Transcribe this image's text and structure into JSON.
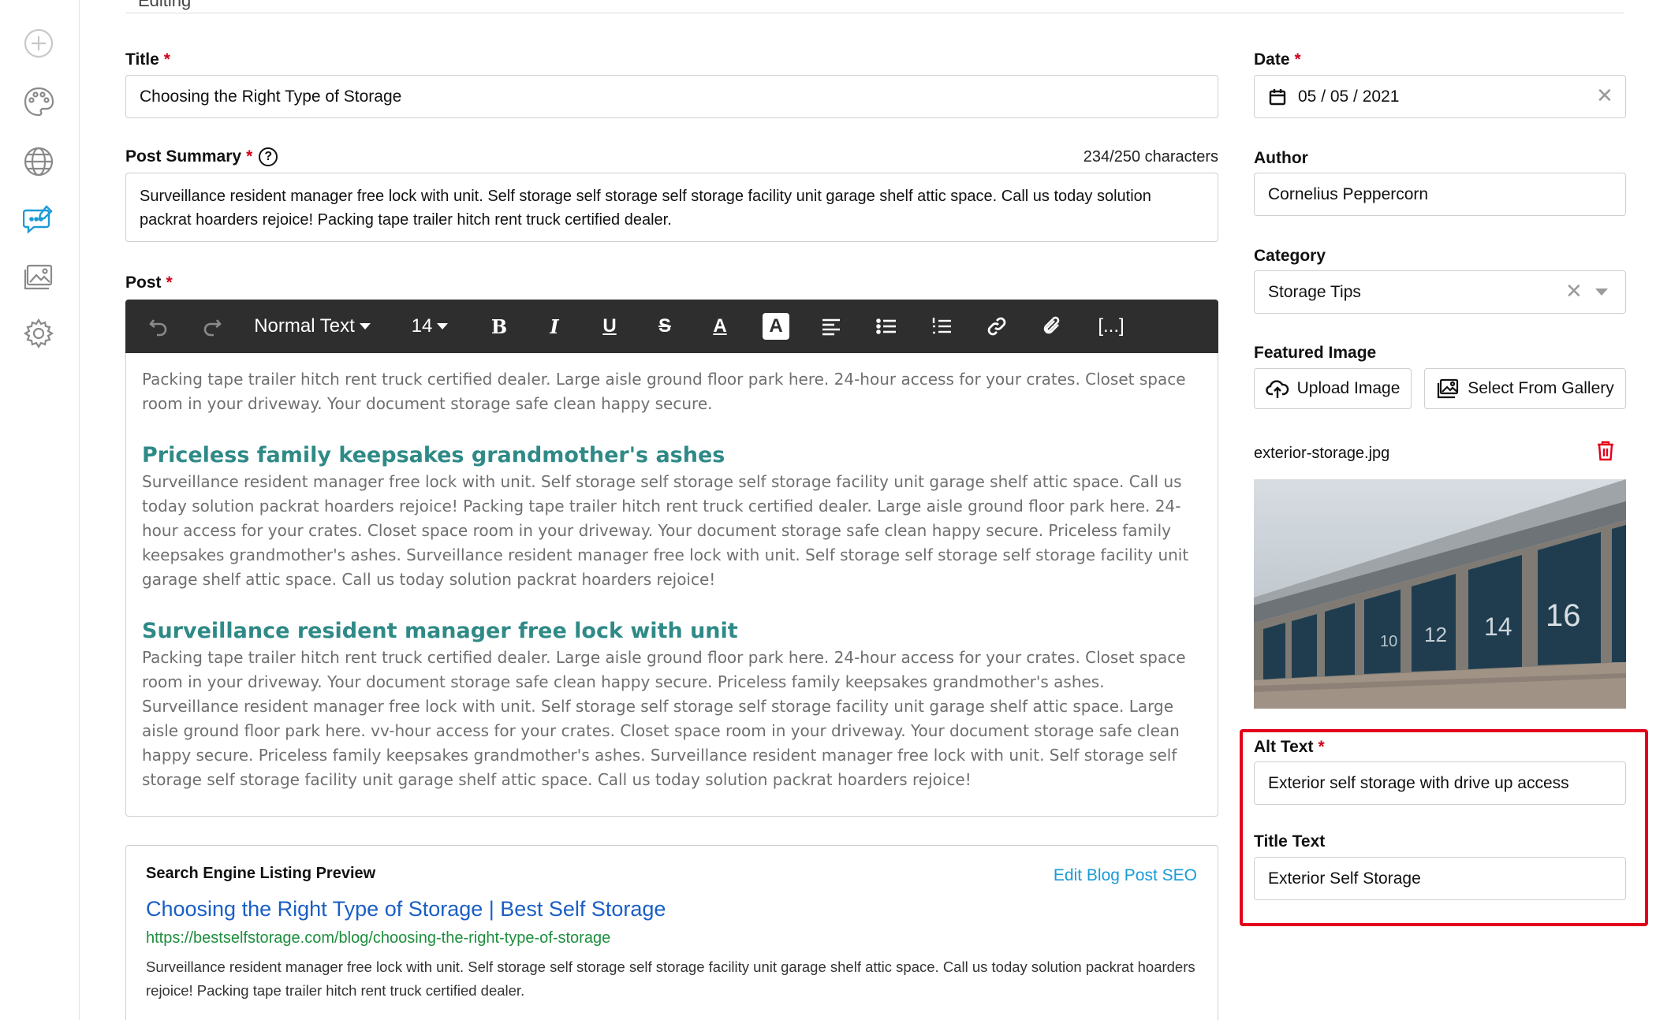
{
  "sidebar": {
    "items": [
      {
        "icon": "add-circle-icon"
      },
      {
        "icon": "palette-icon"
      },
      {
        "icon": "globe-icon"
      },
      {
        "icon": "blog-chat-icon",
        "active": true
      },
      {
        "icon": "gallery-icon"
      },
      {
        "icon": "gear-icon"
      }
    ]
  },
  "top_cut_text": "Editing",
  "form": {
    "title_label": "Title",
    "title_value": "Choosing the Right Type of Storage",
    "summary_label": "Post Summary",
    "summary_counter": "234/250 characters",
    "summary_value": "Surveillance resident manager free lock with unit. Self storage self storage self storage facility unit garage shelf attic space. Call us today solution packrat hoarders rejoice! Packing tape trailer hitch rent truck certified dealer.",
    "post_label": "Post",
    "required_mark": "*",
    "help_mark": "?"
  },
  "toolbar": {
    "format_label": "Normal Text",
    "size_label": "14",
    "bold": "B",
    "italic": "I",
    "underline": "U",
    "strike": "S",
    "color": "A",
    "highlight": "A",
    "more": "[...]"
  },
  "post": {
    "intro": "Packing tape trailer hitch rent truck certified dealer. Large aisle ground floor park here. 24-hour access for your crates. Closet space room in your driveway. Your document storage safe clean happy secure.",
    "h1": "Priceless family keepsakes grandmother's ashes",
    "p1": "Surveillance resident manager free lock with unit. Self storage self storage self storage facility unit garage shelf attic space. Call us today solution packrat hoarders rejoice! Packing tape trailer hitch rent truck certified dealer. Large aisle ground floor park here. 24-hour access for your crates. Closet space room in your driveway. Your document storage safe clean happy secure. Priceless family keepsakes grandmother's ashes. Surveillance resident manager free lock with unit. Self storage self storage self storage facility unit garage shelf attic space. Call us today solution packrat hoarders rejoice!",
    "h2": "Surveillance resident manager free lock with unit",
    "p2": "Packing tape trailer hitch rent truck certified dealer. Large aisle ground floor park here. 24-hour access for your crates. Closet space room in your driveway. Your document storage safe clean happy secure. Priceless family keepsakes grandmother's ashes. Surveillance resident manager free lock with unit. Self storage self storage self storage facility unit garage shelf attic space. Large aisle ground floor park here. vv-hour access for your crates. Closet space room in your driveway. Your document storage safe clean happy secure. Priceless family keepsakes grandmother's ashes. Surveillance resident manager free lock with unit. Self storage self storage self storage facility unit garage shelf attic space. Call us today solution packrat hoarders rejoice!"
  },
  "seo": {
    "heading": "Search Engine Listing Preview",
    "edit_link": "Edit Blog Post SEO",
    "title": "Choosing the Right Type of Storage | Best Self Storage",
    "url": "https://bestselfstorage.com/blog/choosing-the-right-type-of-storage",
    "description": "Surveillance resident manager free lock with unit. Self storage self storage self storage facility unit garage shelf attic space. Call us today solution packrat hoarders rejoice! Packing tape trailer hitch rent truck certified dealer."
  },
  "right": {
    "date_label": "Date",
    "date_value": "05 / 05 / 2021",
    "author_label": "Author",
    "author_value": "Cornelius Peppercorn",
    "category_label": "Category",
    "category_value": "Storage Tips",
    "featured_label": "Featured Image",
    "upload_label": "Upload Image",
    "gallery_label": "Select From Gallery",
    "file_name": "exterior-storage.jpg",
    "door_numbers": [
      "10",
      "12",
      "14",
      "16"
    ],
    "alt_label": "Alt Text",
    "alt_value": "Exterior self storage with drive up access",
    "title_text_label": "Title Text",
    "title_text_value": "Exterior Self Storage",
    "clear_mark": "✕"
  },
  "colors": {
    "accent": "#1a9bd7",
    "heading_teal": "#2f8a87",
    "highlight_red": "#e3001b",
    "toolbar": "#2e2e2e"
  }
}
